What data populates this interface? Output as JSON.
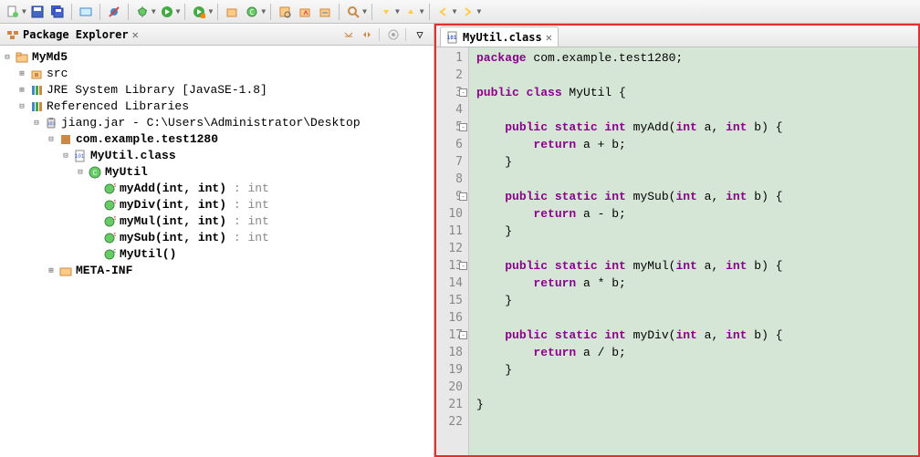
{
  "toolbar": {
    "items": [
      "new-menu",
      "save",
      "save-all",
      "sep",
      "print",
      "sep",
      "build",
      "sep",
      "skip-breakpoints",
      "sep",
      "debug-menu",
      "run-menu",
      "sep",
      "run-last",
      "sep",
      "new-package",
      "new-class",
      "sep",
      "open-type",
      "sep",
      "search-menu",
      "sep",
      "next-annotation",
      "prev-annotation",
      "sep",
      "back-menu",
      "forward-menu"
    ]
  },
  "package_explorer": {
    "title": "Package Explorer",
    "tree": {
      "project": "MyMd5",
      "src": "src",
      "jre": "JRE System Library",
      "jre_ver": "[JavaSE-1.8]",
      "ref_lib": "Referenced Libraries",
      "jar": "jiang.jar",
      "jar_path": " - C:\\Users\\Administrator\\Desktop",
      "pkg": "com.example.test1280",
      "class": "MyUtil.class",
      "type": "MyUtil",
      "methods": [
        {
          "sig": "myAdd(int, int)",
          "ret": "int"
        },
        {
          "sig": "myDiv(int, int)",
          "ret": "int"
        },
        {
          "sig": "myMul(int, int)",
          "ret": "int"
        },
        {
          "sig": "mySub(int, int)",
          "ret": "int"
        },
        {
          "sig": "MyUtil()",
          "ret": ""
        }
      ],
      "meta": "META-INF"
    }
  },
  "editor": {
    "tab": "MyUtil.class",
    "lines": [
      {
        "n": 1,
        "t": [
          [
            "kw",
            "package"
          ],
          [
            "pkg",
            " com.example.test1280;"
          ]
        ]
      },
      {
        "n": 2,
        "t": []
      },
      {
        "n": 3,
        "fold": true,
        "t": [
          [
            "kw",
            "public class"
          ],
          [
            "cls",
            " MyUtil {"
          ]
        ]
      },
      {
        "n": 4,
        "t": []
      },
      {
        "n": 5,
        "fold": true,
        "t": [
          [
            "",
            "    "
          ],
          [
            "kw",
            "public static int"
          ],
          [
            "mth",
            " myAdd("
          ],
          [
            "kw",
            "int"
          ],
          [
            "",
            " a, "
          ],
          [
            "kw",
            "int"
          ],
          [
            "",
            " b) {"
          ]
        ]
      },
      {
        "n": 6,
        "t": [
          [
            "",
            "        "
          ],
          [
            "kw",
            "return"
          ],
          [
            "",
            " a + b;"
          ]
        ]
      },
      {
        "n": 7,
        "t": [
          [
            "",
            "    }"
          ]
        ]
      },
      {
        "n": 8,
        "t": []
      },
      {
        "n": 9,
        "fold": true,
        "t": [
          [
            "",
            "    "
          ],
          [
            "kw",
            "public static int"
          ],
          [
            "mth",
            " mySub("
          ],
          [
            "kw",
            "int"
          ],
          [
            "",
            " a, "
          ],
          [
            "kw",
            "int"
          ],
          [
            "",
            " b) {"
          ]
        ]
      },
      {
        "n": 10,
        "t": [
          [
            "",
            "        "
          ],
          [
            "kw",
            "return"
          ],
          [
            "",
            " a - b;"
          ]
        ]
      },
      {
        "n": 11,
        "t": [
          [
            "",
            "    }"
          ]
        ]
      },
      {
        "n": 12,
        "t": []
      },
      {
        "n": 13,
        "fold": true,
        "t": [
          [
            "",
            "    "
          ],
          [
            "kw",
            "public static int"
          ],
          [
            "mth",
            " myMul("
          ],
          [
            "kw",
            "int"
          ],
          [
            "",
            " a, "
          ],
          [
            "kw",
            "int"
          ],
          [
            "",
            " b) {"
          ]
        ]
      },
      {
        "n": 14,
        "t": [
          [
            "",
            "        "
          ],
          [
            "kw",
            "return"
          ],
          [
            "",
            " a * b;"
          ]
        ]
      },
      {
        "n": 15,
        "t": [
          [
            "",
            "    }"
          ]
        ]
      },
      {
        "n": 16,
        "t": []
      },
      {
        "n": 17,
        "fold": true,
        "t": [
          [
            "",
            "    "
          ],
          [
            "kw",
            "public static int"
          ],
          [
            "mth",
            " myDiv("
          ],
          [
            "kw",
            "int"
          ],
          [
            "",
            " a, "
          ],
          [
            "kw",
            "int"
          ],
          [
            "",
            " b) {"
          ]
        ]
      },
      {
        "n": 18,
        "t": [
          [
            "",
            "        "
          ],
          [
            "kw",
            "return"
          ],
          [
            "",
            " a / b;"
          ]
        ]
      },
      {
        "n": 19,
        "t": [
          [
            "",
            "    }"
          ]
        ]
      },
      {
        "n": 20,
        "t": []
      },
      {
        "n": 21,
        "t": [
          [
            "",
            "}"
          ]
        ]
      },
      {
        "n": 22,
        "t": []
      }
    ]
  }
}
